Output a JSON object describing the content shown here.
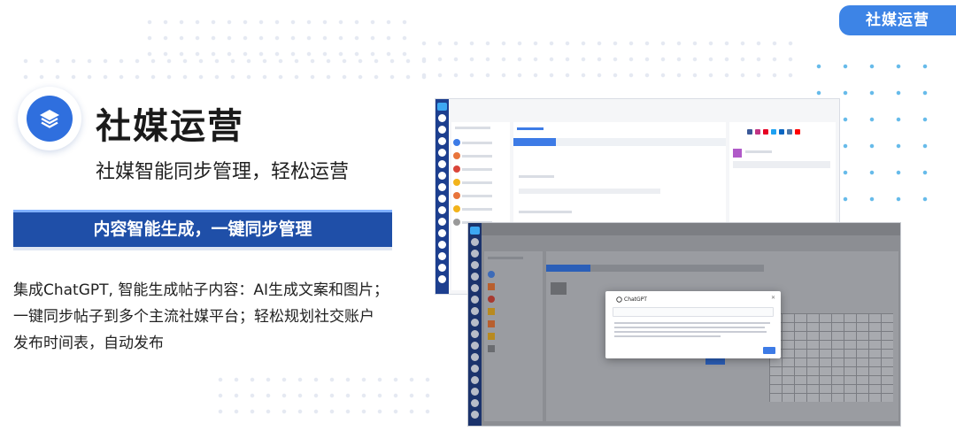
{
  "badge": {
    "label": "社媒运营"
  },
  "header": {
    "title": "社媒运营",
    "subtitle": "社媒智能同步管理，轻松运营"
  },
  "banner": {
    "label": "内容智能生成，一键同步管理"
  },
  "description": {
    "lines": [
      "集成ChatGPT, 智能生成帖子内容：AI生成文案和图片；",
      "一键同步帖子到多个主流社媒平台；轻松规划社交账户",
      "发布时间表，自动发布"
    ]
  },
  "screenshots": {
    "modal_title": "ChatGPT"
  },
  "icons": {
    "logo": "layers-icon",
    "social": [
      "facebook-icon",
      "instagram-icon",
      "pinterest-icon",
      "twitter-icon",
      "linkedin-icon",
      "vk-icon",
      "youtube-icon"
    ]
  },
  "colors": {
    "brand_blue": "#1f4fa8",
    "accent_blue": "#3d84e6",
    "rail_blue": "#1d3f8f"
  }
}
